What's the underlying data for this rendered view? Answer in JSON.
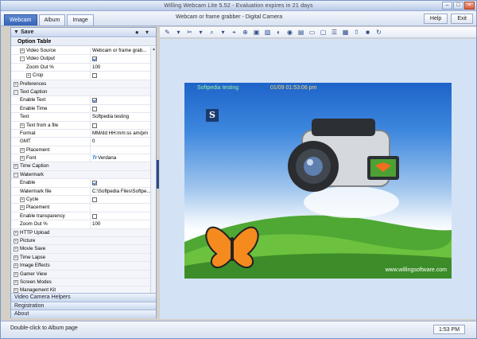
{
  "window": {
    "title": "Willing Webcam Lite 5.52 - Evaluation expires in 21 days"
  },
  "tabs": [
    {
      "label": "Webcam",
      "active": true
    },
    {
      "label": "Album",
      "active": false
    },
    {
      "label": "Image",
      "active": false
    }
  ],
  "document_title": "Webcam or frame grabber - Digital Camera",
  "header_buttons": {
    "help": "Help",
    "exit": "Exit"
  },
  "save_bar": {
    "label": "Save",
    "indicators": "● ▾"
  },
  "option_table": {
    "title": "Option Table",
    "rows": [
      {
        "label": "Video Source",
        "indent": 1,
        "expander": "plus",
        "section": false,
        "value": "Webcam or frame grab..."
      },
      {
        "label": "Video Output",
        "indent": 1,
        "expander": "minus",
        "section": false,
        "checkbox": "on"
      },
      {
        "label": "Zoom Out %",
        "indent": 2,
        "section": false,
        "value": "100"
      },
      {
        "label": "Crop",
        "indent": 2,
        "expander": "plus",
        "section": false,
        "checkbox": "off"
      },
      {
        "label": "Preferences",
        "indent": 0,
        "expander": "plus",
        "section": true
      },
      {
        "label": "Text Caption",
        "indent": 0,
        "expander": "minus",
        "section": true
      },
      {
        "label": "Enable Text",
        "indent": 1,
        "section": false,
        "checkbox": "on"
      },
      {
        "label": "Enable Time",
        "indent": 1,
        "section": false,
        "checkbox": "off"
      },
      {
        "label": "Text",
        "indent": 1,
        "section": false,
        "value": "Softpedia testing"
      },
      {
        "label": "Text from a file",
        "indent": 1,
        "expander": "plus",
        "section": false,
        "checkbox": "off"
      },
      {
        "label": "Format",
        "indent": 1,
        "section": false,
        "value": "MM/dd HH:mm:ss am/pm"
      },
      {
        "label": "GMT",
        "indent": 1,
        "section": false,
        "value": "0"
      },
      {
        "label": "Placement",
        "indent": 1,
        "expander": "plus",
        "section": false
      },
      {
        "label": "Font",
        "indent": 1,
        "expander": "plus",
        "section": false,
        "value": "Verdana",
        "font_icon": "Tr"
      },
      {
        "label": "Time Caption",
        "indent": 0,
        "expander": "plus",
        "section": true
      },
      {
        "label": "Watermark",
        "indent": 0,
        "expander": "minus",
        "section": true
      },
      {
        "label": "Enable",
        "indent": 1,
        "section": false,
        "checkbox": "on"
      },
      {
        "label": "Watermark file",
        "indent": 1,
        "section": false,
        "value": "C:\\Softpedia Files\\Softpe..."
      },
      {
        "label": "Cycle",
        "indent": 1,
        "expander": "plus",
        "section": false,
        "checkbox": "off"
      },
      {
        "label": "Placement",
        "indent": 1,
        "expander": "plus",
        "section": false
      },
      {
        "label": "Enable transparency",
        "indent": 1,
        "section": false,
        "checkbox": "off"
      },
      {
        "label": "Zoom Out %",
        "indent": 1,
        "section": false,
        "value": "100"
      },
      {
        "label": "HTTP Upload",
        "indent": 0,
        "expander": "plus",
        "section": true
      },
      {
        "label": "Picture",
        "indent": 0,
        "expander": "plus",
        "section": true
      },
      {
        "label": "Movie Save",
        "indent": 0,
        "expander": "plus",
        "section": true
      },
      {
        "label": "Time Lapse",
        "indent": 0,
        "expander": "plus",
        "section": true
      },
      {
        "label": "Image Effects",
        "indent": 0,
        "expander": "plus",
        "section": true
      },
      {
        "label": "Gamer View",
        "indent": 0,
        "expander": "plus",
        "section": true
      },
      {
        "label": "Screen Modes",
        "indent": 0,
        "expander": "plus",
        "section": true
      },
      {
        "label": "Management Kit",
        "indent": 0,
        "expander": "plus",
        "section": true
      }
    ]
  },
  "bottom_sections": [
    {
      "label": "Video Camera Helpers"
    },
    {
      "label": "Registration"
    },
    {
      "label": "About"
    }
  ],
  "toolbar_icons": [
    "edit-icon",
    "dropdown-icon",
    "crop-tool-icon",
    "dropdown-icon",
    "zoom-icon",
    "dropdown-icon",
    "fit-icon",
    "add-icon",
    "image-icon",
    "photo-icon",
    "color-icon",
    "record-icon",
    "camera-icon",
    "monitor-icon",
    "screen-icon",
    "filmstrip-icon",
    "image-folder-icon",
    "upload-icon",
    "save-icon",
    "refresh-icon"
  ],
  "photo": {
    "caption_text": "Softpedia testing",
    "caption_time": "01/09 01:53:06 pm",
    "watermark_letter": "S",
    "site_url": "www.willingsoftware.com"
  },
  "status": {
    "message": "Double-click to Album page",
    "time": "1:53 PM"
  },
  "colors": {
    "accent": "#3664b7",
    "panel_border": "#8ea4cc",
    "canvas_bg": "#d4e2f5"
  }
}
